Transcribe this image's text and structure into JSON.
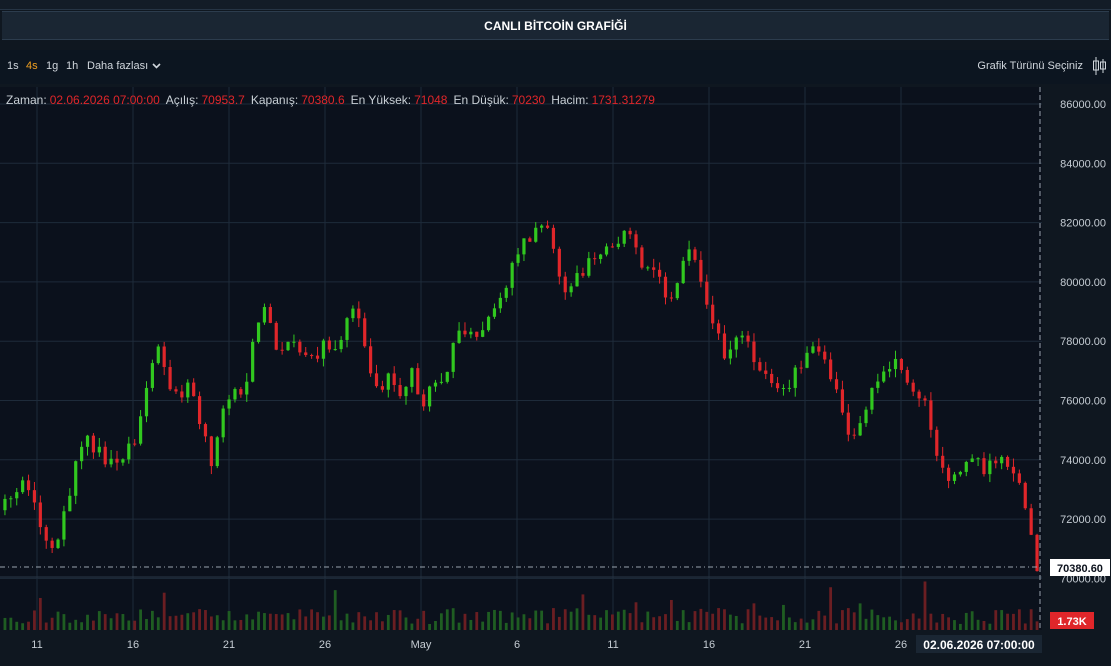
{
  "header": {
    "title": "CANLI BİTCOİN GRAFİĞİ"
  },
  "toolbar": {
    "timeframes": [
      "1s",
      "4s",
      "1g",
      "1h"
    ],
    "active_timeframe": "4s",
    "more_label": "Daha fazlası",
    "chart_type_label": "Grafik Türünü Seçiniz"
  },
  "ohlc": {
    "time_label": "Zaman:",
    "time_value": "02.06.2026 07:00:00",
    "open_label": "Açılış:",
    "open_value": "70953.7",
    "close_label": "Kapanış:",
    "close_value": "70380.6",
    "high_label": "En Yüksek:",
    "high_value": "71048",
    "low_label": "En Düşük:",
    "low_value": "70230",
    "volume_label": "Hacim:",
    "volume_value": "1731.31279"
  },
  "colors": {
    "up": "#31c81f",
    "down": "#e0262a",
    "background": "#0f1720",
    "grid": "#1e2b3a",
    "axis_text": "#c5ccd3",
    "price_label_bg": "#ffffff",
    "volume_label_bg": "#e0262a"
  },
  "chart_data": {
    "type": "candlestick",
    "ylim": [
      69500,
      86700
    ],
    "y_ticks": [
      "86000.00",
      "84000.00",
      "82000.00",
      "80000.00",
      "78000.00",
      "76000.00",
      "74000.00",
      "72000.00",
      "70000.00"
    ],
    "x_ticks": [
      "11",
      "16",
      "21",
      "26",
      "May",
      "6",
      "11",
      "16",
      "21",
      "26"
    ],
    "last_price_label": "70380.60",
    "last_volume_label": "1.73K",
    "crosshair_time_label": "02.06.2026 07:00:00",
    "grid": true,
    "close_path": [
      72300,
      72600,
      73300,
      72800,
      71400,
      71000,
      72300,
      74000,
      74700,
      74200,
      73800,
      74100,
      74500,
      75800,
      77900,
      76700,
      76000,
      76500,
      75200,
      74000,
      75600,
      76300,
      76000,
      78600,
      79300,
      77600,
      78000,
      77700,
      77300,
      77900,
      77600,
      78500,
      79200,
      77500,
      76300,
      77000,
      76200,
      77000,
      75800,
      76600,
      77000,
      78100,
      78400,
      78300,
      78900,
      79600,
      80500,
      81300,
      81600,
      82000,
      80500,
      79600,
      80200,
      80700,
      80800,
      81200,
      81600,
      81200,
      80300,
      80100,
      79300,
      80200,
      81300,
      79700,
      78400,
      77600,
      78100,
      78000,
      77000,
      76700,
      76400,
      76700,
      77200,
      77800,
      77400,
      76400,
      74800,
      75000,
      76300,
      76900,
      77300,
      77000,
      76400,
      75800,
      74000,
      73400,
      73300,
      74100,
      73700,
      73900,
      74100,
      73700,
      72100,
      70400
    ]
  }
}
